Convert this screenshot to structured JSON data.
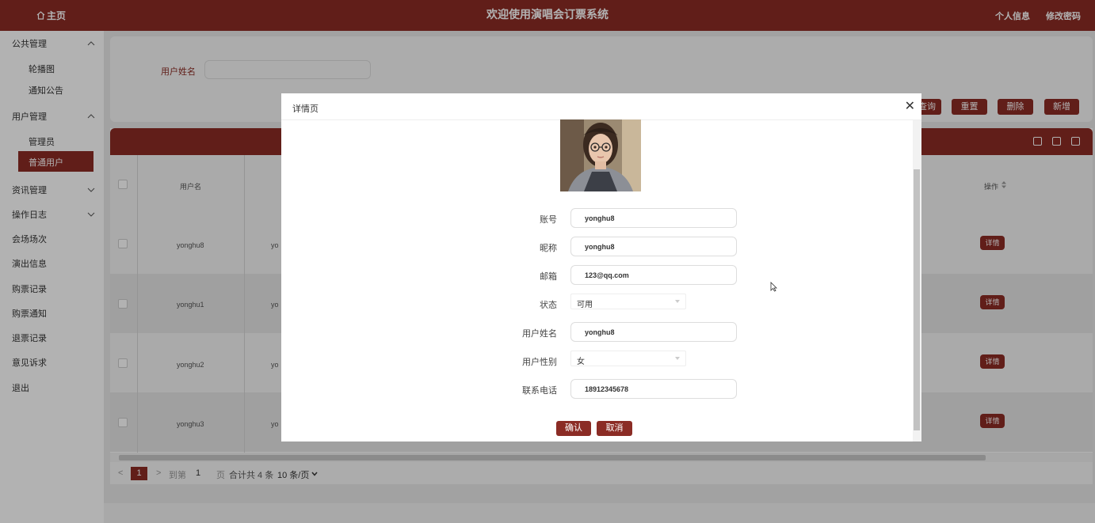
{
  "header": {
    "home_label": "主页",
    "title": "欢迎使用演唱会订票系统",
    "profile_label": "个人信息",
    "change_password_label": "修改密码"
  },
  "sidebar": {
    "groups": [
      {
        "label": "公共管理",
        "expanded": true,
        "items": [
          "轮播图",
          "通知公告"
        ]
      },
      {
        "label": "用户管理",
        "expanded": true,
        "items": [
          "管理员",
          "普通用户"
        ]
      },
      {
        "label": "资讯管理",
        "expanded": false
      },
      {
        "label": "操作日志",
        "expanded": false
      }
    ],
    "items": [
      "会场场次",
      "演出信息",
      "购票记录",
      "购票通知",
      "退票记录",
      "意见诉求",
      "退出"
    ],
    "active_item": "普通用户"
  },
  "search": {
    "label": "用户姓名",
    "value": "",
    "buttons": [
      "查询",
      "重置",
      "删除",
      "新增"
    ]
  },
  "table": {
    "col_username": "用户名",
    "col_actions": "操作",
    "rows": [
      {
        "username": "yonghu8",
        "col2": "yo",
        "action": "详情"
      },
      {
        "username": "yonghu1",
        "col2": "yo",
        "action": "详情"
      },
      {
        "username": "yonghu2",
        "col2": "yo",
        "action": "详情"
      },
      {
        "username": "yonghu3",
        "col2": "yo",
        "action": "详情"
      }
    ]
  },
  "pagination": {
    "current_page": "1",
    "goto_prefix": "到第",
    "goto_value": "1",
    "goto_suffix": "页",
    "total": "合计共 4 条",
    "page_size": "10 条/页"
  },
  "dialog": {
    "title": "详情页",
    "fields": {
      "account_label": "账号",
      "account_value": "yonghu8",
      "nickname_label": "昵称",
      "nickname_value": "yonghu8",
      "email_label": "邮箱",
      "email_value": "123@qq.com",
      "status_label": "状态",
      "status_value": "可用",
      "name_label": "用户姓名",
      "name_value": "yonghu8",
      "gender_label": "用户性别",
      "gender_value": "女",
      "phone_label": "联系电话",
      "phone_value": "18912345678"
    },
    "confirm_label": "确认",
    "cancel_label": "取消"
  },
  "colors": {
    "brand": "#8b2c25",
    "overlay": "rgba(0,0,0,0.3)"
  }
}
